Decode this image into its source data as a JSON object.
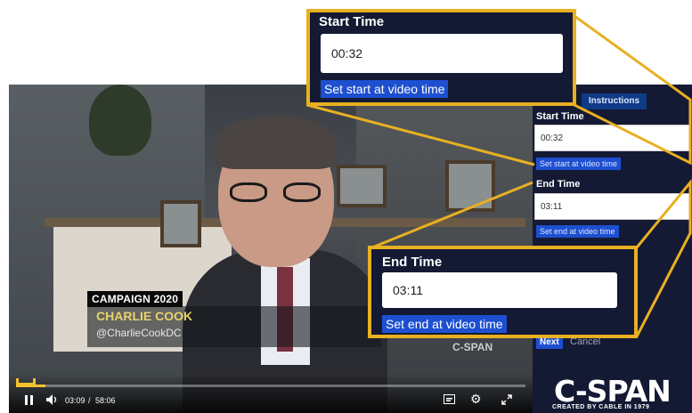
{
  "video": {
    "lower_third_tag": "CAMPAIGN 2020",
    "lower_third_name": "CHARLIE COOK",
    "lower_third_handle": "@CharlieCookDC",
    "watermark": "C-SPAN",
    "current_time": "03:09",
    "time_separator": "/",
    "duration": "58:06",
    "progress": 0.054,
    "accent_color": "#f2c230",
    "icons": [
      "clip-marker-icon",
      "pause-icon",
      "volume-icon",
      "captions-icon",
      "settings-icon",
      "fullscreen-icon"
    ]
  },
  "panel": {
    "instructions_label": "Instructions",
    "start_label": "Start Time",
    "start_value": "00:32",
    "set_start_label": "Set start at video time",
    "end_label": "End Time",
    "end_value": "03:11",
    "set_end_label": "Set end at video time",
    "next_label": "Next",
    "cancel_label": "Cancel",
    "logo_text": "C-SPAN",
    "logo_subtext": "CREATED BY CABLE IN 1979"
  },
  "callout_start": {
    "label": "Start Time",
    "value": "00:32",
    "button": "Set start at video time"
  },
  "callout_end": {
    "label": "End Time",
    "value": "03:11",
    "button": "Set end at video time"
  },
  "colors": {
    "callout_border": "#e8b022",
    "panel_bg": "#141a33",
    "button_blue": "#1d4fd0"
  }
}
